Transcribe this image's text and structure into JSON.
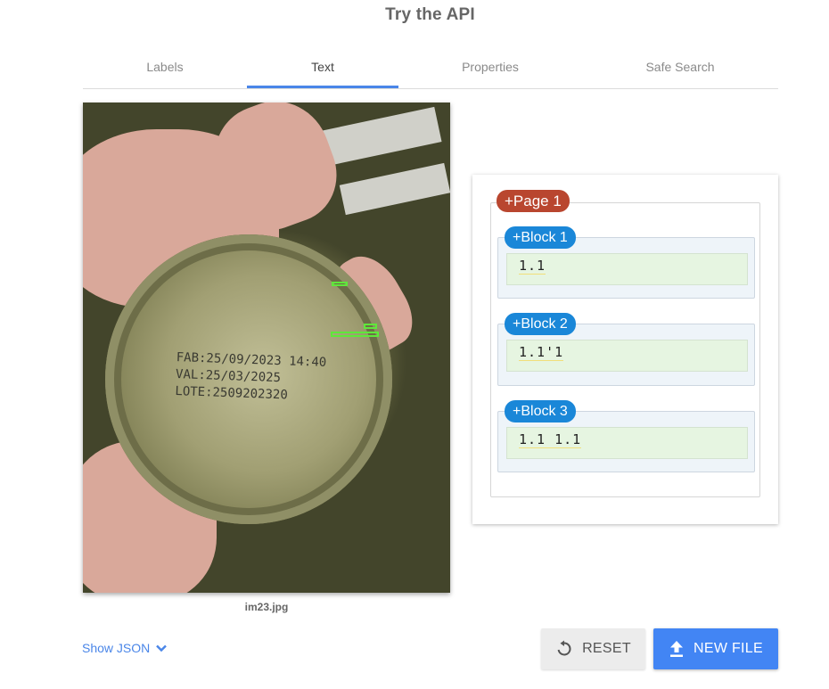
{
  "header": {
    "title": "Try the API"
  },
  "tabs": [
    {
      "label": "Labels"
    },
    {
      "label": "Text",
      "active": true
    },
    {
      "label": "Properties"
    },
    {
      "label": "Safe Search"
    }
  ],
  "image": {
    "filename": "im23.jpg",
    "printed_text": "FAB:25/09/2023 14:40\nVAL:25/03/2025\nLOTE:2509202320"
  },
  "results": {
    "page_label": "+Page 1",
    "blocks": [
      {
        "label": "+Block 1",
        "text": "1.1"
      },
      {
        "label": "+Block 2",
        "text": "1.1'1"
      },
      {
        "label": "+Block 3",
        "text": "1.1 1.1"
      }
    ]
  },
  "footer": {
    "show_json_label": "Show JSON",
    "reset_label": "RESET",
    "new_file_label": "NEW FILE"
  },
  "colors": {
    "accent": "#4285f4",
    "page_pill": "#b9462f",
    "block_pill": "#1a87d8",
    "bbox": "#5ee83a"
  }
}
